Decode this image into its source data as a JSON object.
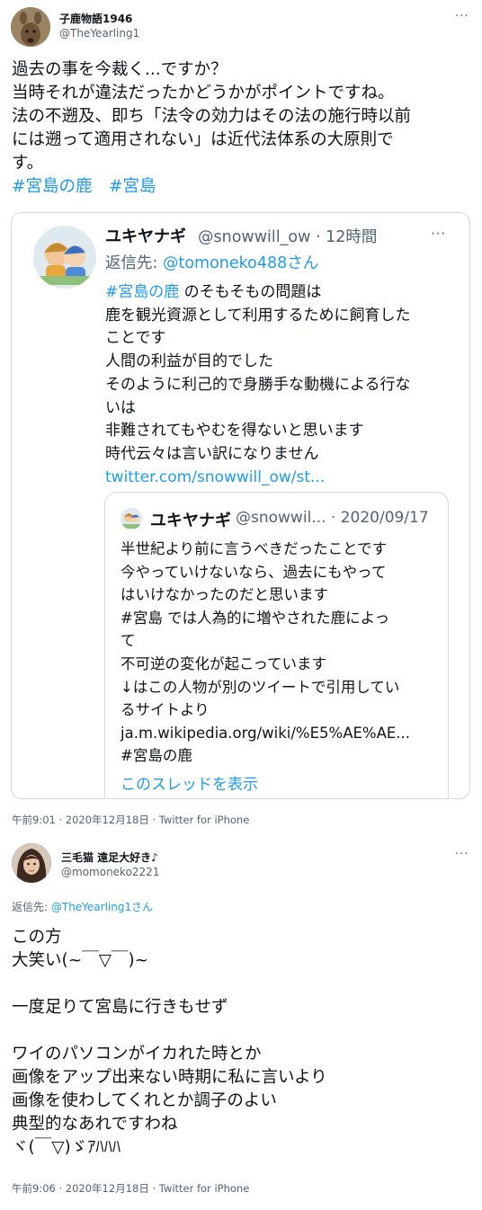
{
  "tweet1": {
    "name": "子鹿物語1946",
    "handle": "@TheYearling1",
    "more": "···",
    "body_lines": [
      "過去の事を今裁く...ですか？",
      "当時それが違法だったかどうかがポイントですね。",
      "法の不遡及、即ち「法令の効力はその法の施行時以前",
      "には遡って適用されない」は近代法体系の大原則で",
      "す。"
    ],
    "hashtags": [
      "#宮島の鹿",
      "#宮島"
    ],
    "timestamp": "午前9:01 · 2020年12月18日",
    "source": "Twitter for iPhone"
  },
  "quote": {
    "name": "ユキヤナギ",
    "handle": "@snowwill_ow · 12時間",
    "more": "···",
    "reply_prefix": "返信先: ",
    "reply_to": "@tomoneko488さん",
    "hashtag": "#宮島の鹿",
    "body_first_rest": " のそもそもの問題は",
    "body_lines": [
      "鹿を観光資源として利用するために飼育した",
      "ことです",
      "人間の利益が目的でした",
      "そのように利己的で身勝手な動機による行な",
      "いは",
      "非難されてもやむを得ないと思います",
      "時代云々は言い訳になりません"
    ],
    "link": "twitter.com/snowwill_ow/st...",
    "inner": {
      "name": "ユキヤナギ",
      "handle": "@snowwil... · 2020/09/17",
      "body_lines": [
        "半世紀より前に言うべきだったことです",
        "今やっていけないなら、過去にもやって",
        "はいけなかったのだと思います",
        "#宮島 では人為的に増やされた鹿によっ",
        "て",
        "不可逆の変化が起こっています",
        "↓はこの人物が別のツイートで引用してい",
        "るサイトより",
        "ja.m.wikipedia.org/wiki/%E5%AE%AE...",
        "#宮島の鹿"
      ],
      "thread_link": "このスレッドを表示"
    }
  },
  "tweet2": {
    "name": "三毛猫 遠足大好き♪",
    "handle": "@momoneko2221",
    "more": "···",
    "reply_prefix": "返信先: ",
    "reply_to": "@TheYearling1さん",
    "body_lines": [
      "この方",
      "大笑い(~￣▽￣)~",
      "",
      "一度足りて宮島に行きもせず",
      "",
      "ワイのパソコンがイカれた時とか",
      "画像をアップ出来ない時期に私に言いより",
      "画像を使わしてくれとか調子のよい",
      "典型的なあれですわね",
      "ヾ(￣▽)ゞｱﾊﾊﾊ"
    ],
    "timestamp": "午前9:06 · 2020年12月18日",
    "source": "Twitter for iPhone"
  }
}
